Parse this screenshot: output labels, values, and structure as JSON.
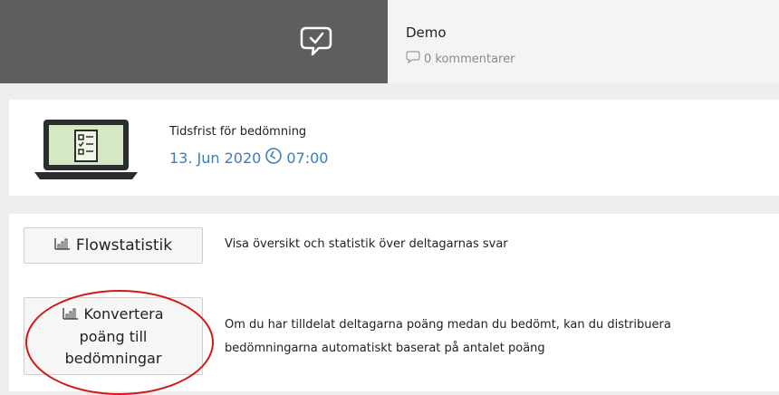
{
  "header": {
    "title": "Demo",
    "comments_label": "0 kommentarer"
  },
  "deadline": {
    "label": "Tidsfrist för bedömning",
    "date": "13. Jun 2020",
    "time": "07:00"
  },
  "actions": {
    "flow_button": "Flowstatistik",
    "flow_description": "Visa översikt och statistik över deltagarnas svar",
    "convert_button_line1": "Konvertera",
    "convert_button_line2": "poäng till",
    "convert_button_line3": "bedömningar",
    "convert_description": "Om du har tilldelat deltagarna poäng medan du bedömt, kan du distribuera bedömningarna automatiskt baserat på antalet poäng"
  },
  "colors": {
    "header_dark": "#5e5e5e",
    "accent_blue": "#3b7bbf",
    "highlight_red": "#d11a1a"
  },
  "icons": {
    "header": "chat-check-icon",
    "comments": "speech-bubble-icon",
    "laptop": "laptop-checklist-icon",
    "clock": "clock-icon",
    "stats": "bar-chart-icon"
  }
}
